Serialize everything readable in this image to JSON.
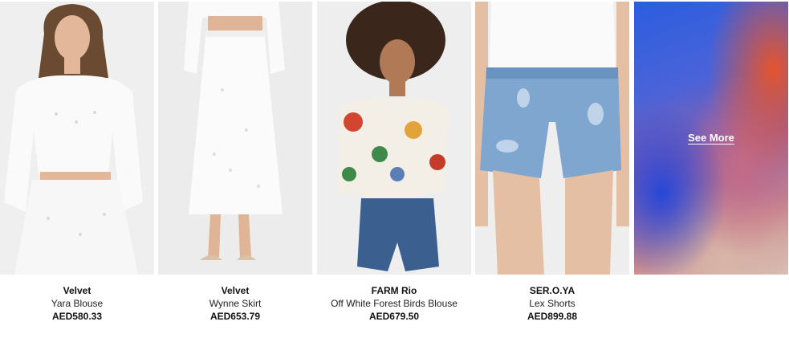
{
  "products": [
    {
      "brand": "Velvet",
      "name": "Yara Blouse",
      "price": "AED580.33",
      "image": "woman-white-eyelet-blouse-and-skirt"
    },
    {
      "brand": "Velvet",
      "name": "Wynne Skirt",
      "price": "AED653.79",
      "image": "white-eyelet-midi-skirt-with-sandals"
    },
    {
      "brand": "FARM Rio",
      "name": "Off White Forest Birds Blouse",
      "price": "AED679.50",
      "image": "woman-printed-blouse-denim-shorts"
    },
    {
      "brand": "SER.O.YA",
      "name": "Lex Shorts",
      "price": "AED899.88",
      "image": "distressed-denim-shorts"
    }
  ],
  "see_more": {
    "label": "See More"
  },
  "colors": {
    "price_text": "#111111",
    "tile_blue": "#2747d8",
    "tile_orange": "#e4542e"
  }
}
